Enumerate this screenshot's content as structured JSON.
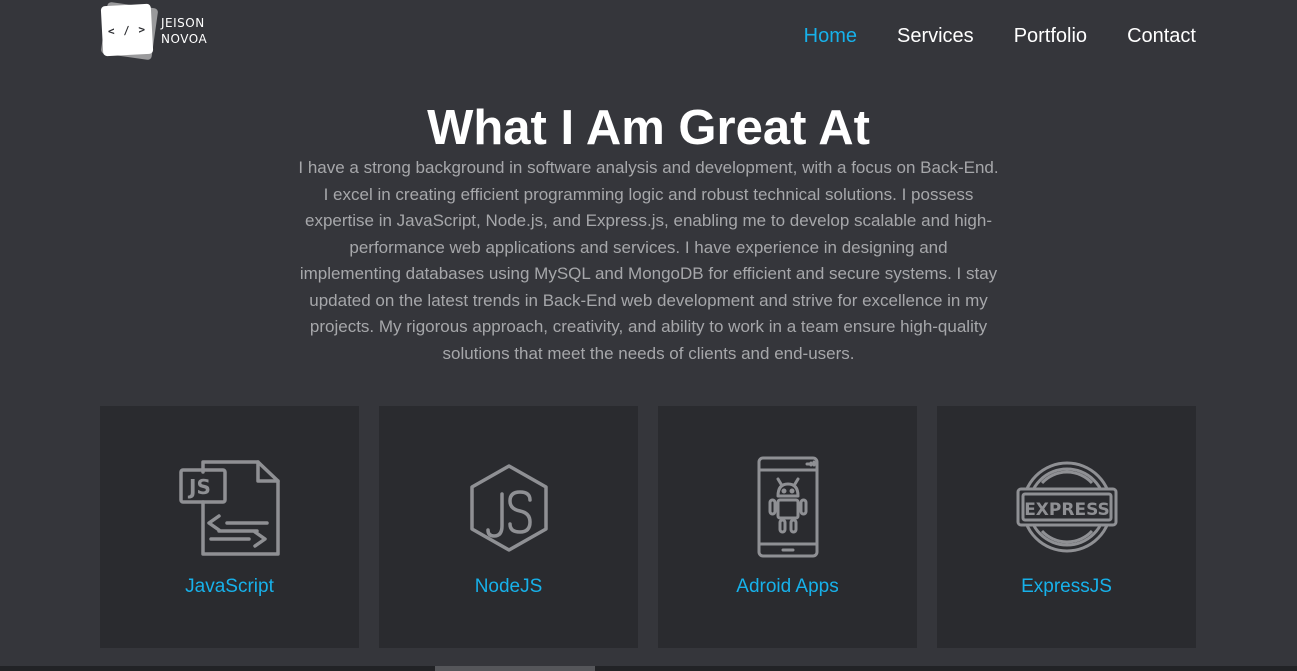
{
  "logo": {
    "mark": "< / >",
    "line1": "JEISON",
    "line2": "NOVOA"
  },
  "nav": {
    "items": [
      {
        "label": "Home",
        "active": true
      },
      {
        "label": "Services"
      },
      {
        "label": "Portfolio"
      },
      {
        "label": "Contact"
      }
    ]
  },
  "main": {
    "title": "What I Am Great At",
    "intro": "I have a strong background in software analysis and development, with a focus on Back-End. I excel in creating efficient programming logic and robust technical solutions. I possess expertise in JavaScript, Node.js, and Express.js, enabling me to develop scalable and high-performance web applications and services. I have experience in designing and implementing databases using MySQL and MongoDB for efficient and secure systems. I stay updated on the latest trends in Back-End web development and strive for excellence in my projects. My rigorous approach, creativity, and ability to work in a team ensure high-quality solutions that meet the needs of clients and end-users."
  },
  "skills": [
    {
      "label": "JavaScript",
      "icon": "js-file-icon"
    },
    {
      "label": "NodeJS",
      "icon": "nodejs-icon"
    },
    {
      "label": "Adroid Apps",
      "icon": "android-phone-icon"
    },
    {
      "label": "ExpressJS",
      "icon": "express-stamp-icon"
    }
  ],
  "colors": {
    "background": "#35363b",
    "card": "#2a2b2f",
    "accent": "#17b1ea",
    "text_muted": "#a6a7aa"
  }
}
